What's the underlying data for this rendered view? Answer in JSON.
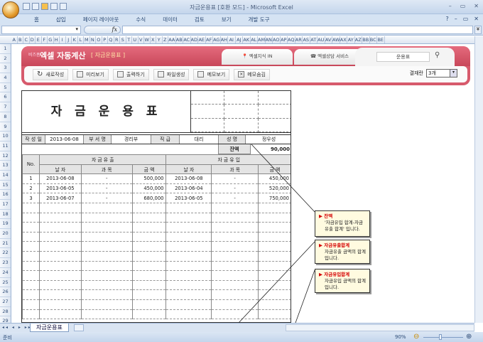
{
  "window": {
    "title": "자금운용표  [호환 모드] - Microsoft Excel",
    "controls": [
      "–",
      "▭",
      "✕"
    ]
  },
  "ribbon": {
    "tabs": [
      "홈",
      "삽입",
      "페이지 레이아웃",
      "수식",
      "데이터",
      "검토",
      "보기",
      "개발 도구"
    ],
    "help": "?",
    "controls": [
      "–",
      "▭",
      "✕"
    ]
  },
  "formula": {
    "fx": "fx",
    "expand": "¥"
  },
  "columns": [
    "A",
    "B",
    "C",
    "D",
    "E",
    "F",
    "G",
    "H",
    "I",
    "J",
    "K",
    "L",
    "M",
    "N",
    "O",
    "P",
    "Q",
    "R",
    "S",
    "T",
    "U",
    "V",
    "W",
    "X",
    "Y",
    "Z",
    "AA",
    "AB",
    "AC",
    "AD",
    "AE",
    "AF",
    "AG",
    "AH",
    "AI",
    "AJ",
    "AK",
    "AL",
    "AM",
    "AN",
    "AO",
    "AP",
    "AQ",
    "AR",
    "AS",
    "AT",
    "AU",
    "AV",
    "AW",
    "AX",
    "AY",
    "AZ",
    "BB",
    "BC",
    "BE"
  ],
  "rows": [
    "1",
    "2",
    "3",
    "4",
    "5",
    "6",
    "7",
    "8",
    "9",
    "10",
    "11",
    "12",
    "13",
    "14",
    "15",
    "16",
    "17",
    "18",
    "19",
    "20",
    "21",
    "22",
    "23",
    "24",
    "25",
    "26",
    "27",
    "28",
    "29"
  ],
  "banner": {
    "brand_small": "비즈폼",
    "brand": "엑셀 자동계산",
    "subtitle": "[ 자금운용표 ]",
    "tab1": "엑셀지식 IN",
    "tab2": "엑셀상담 서비스",
    "search_value": "운용표",
    "buttons": [
      "새로작성",
      "미리보기",
      "출력하기",
      "파일생성",
      "메모보기",
      "메모숨김"
    ],
    "report_label": "결재란",
    "report_value": "3개"
  },
  "form": {
    "title": "자 금 운 용 표",
    "info": {
      "date_label": "작 성 일",
      "date": "2013-06-08",
      "dept_label": "부 서 명",
      "dept": "경리부",
      "rank_label": "직  급",
      "rank": "대리",
      "name_label": "성  명",
      "name": "정우성"
    },
    "balance_label": "잔액",
    "balance": "90,000",
    "headers": {
      "no": "No.",
      "outflow": "자 금 유 출",
      "inflow": "자 금 유 입",
      "date": "날    자",
      "item": "과    목",
      "amount": "금    액"
    },
    "rows": [
      {
        "no": "1",
        "out_date": "2013-06-08",
        "out_item": "-",
        "out_amount": "500,000",
        "in_date": "2013-06-08",
        "in_item": "-",
        "in_amount": "450,000"
      },
      {
        "no": "2",
        "out_date": "2013-06-05",
        "out_item": "-",
        "out_amount": "450,000",
        "in_date": "2013-06-04",
        "in_item": "-",
        "in_amount": "520,000"
      },
      {
        "no": "3",
        "out_date": "2013-06-07",
        "out_item": "-",
        "out_amount": "680,000",
        "in_date": "2013-06-05",
        "in_item": "-",
        "in_amount": "750,000"
      }
    ]
  },
  "notes": [
    {
      "title": "▶ 잔액",
      "body": "'자금유입 합계-자금유출 합계' 입니다."
    },
    {
      "title": "▶ 자금유출합계",
      "body": "자금유출 금액의 합계입니다."
    },
    {
      "title": "▶ 자금유입합계",
      "body": "자금유입 금액의 합계입니다."
    }
  ],
  "sheets": {
    "nav": "◂◂ ◂ ▸ ▸▸",
    "active": "자금운용표"
  },
  "status": {
    "ready": "준비",
    "zoom": "90%"
  }
}
